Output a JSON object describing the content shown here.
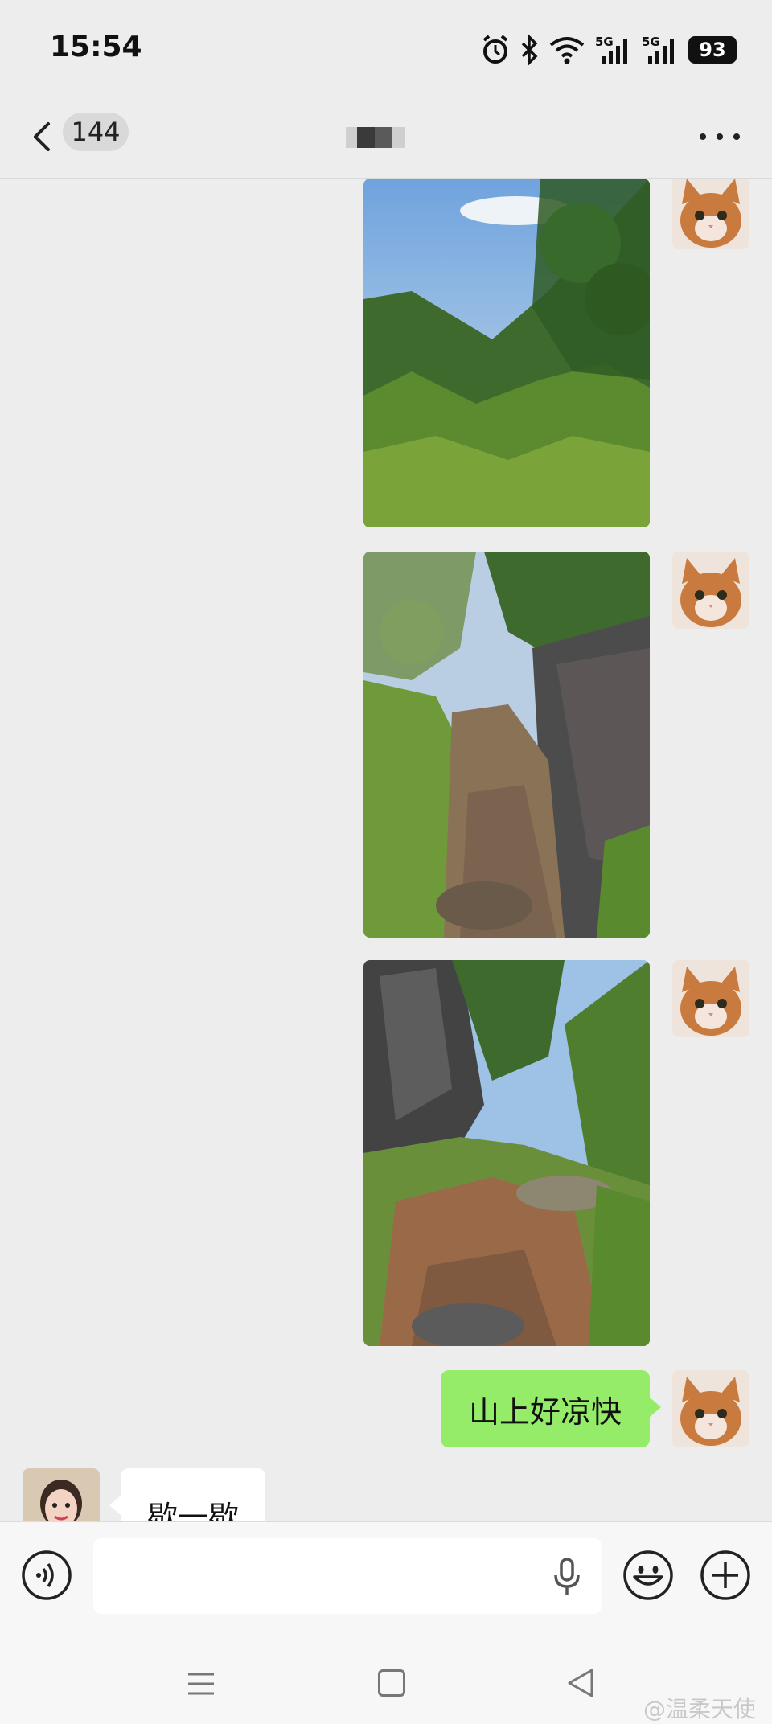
{
  "status_bar": {
    "time": "15:54",
    "battery": "93",
    "icons": [
      "alarm-icon",
      "bluetooth-icon",
      "wifi-icon",
      "signal-5g-icon",
      "signal-5g-icon"
    ]
  },
  "header": {
    "unread_count": "144",
    "title_obscured": true,
    "icons": [
      "back-arrow-icon",
      "more-icon"
    ]
  },
  "messages": [
    {
      "side": "right",
      "type": "image",
      "subject": "mountain view through trees"
    },
    {
      "side": "right",
      "type": "image",
      "subject": "rocky mountain trail"
    },
    {
      "side": "right",
      "type": "image",
      "subject": "rocky path between cliffs"
    },
    {
      "side": "right",
      "type": "text",
      "text": "山上好凉快"
    },
    {
      "side": "left",
      "type": "text",
      "text": "歇一歇"
    }
  ],
  "input_bar": {
    "placeholder": "",
    "icons": [
      "voice-icon",
      "microphone-icon",
      "emoji-icon",
      "plus-icon"
    ]
  },
  "system_nav": {
    "icons": [
      "menu-icon",
      "home-icon",
      "back-icon"
    ],
    "watermark": "@温柔天使"
  },
  "colors": {
    "background": "#ededed",
    "sent_bubble": "#95ec69",
    "received_bubble": "#ffffff"
  }
}
